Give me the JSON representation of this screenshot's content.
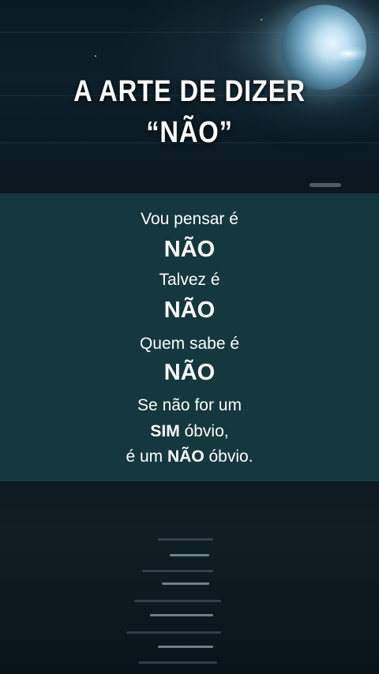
{
  "title": {
    "line1": "A ARTE DE DIZER",
    "line2": "“NÃO”"
  },
  "poem": {
    "l1": "Vou pensar é",
    "l2": "NÃO",
    "l3": "Talvez é",
    "l4": "NÃO",
    "l5": "Quem sabe é",
    "l6": "NÃO",
    "l7": "Se não for um",
    "l8_bold": "SIM",
    "l8_rest": " óbvio,",
    "l9_pre": "é um ",
    "l9_bold": "NÃO",
    "l9_post": " óbvio."
  },
  "colors": {
    "panel": "#14383e",
    "text": "#ffffff",
    "sky": "#0d1f29",
    "sea": "#0c1a1f"
  }
}
